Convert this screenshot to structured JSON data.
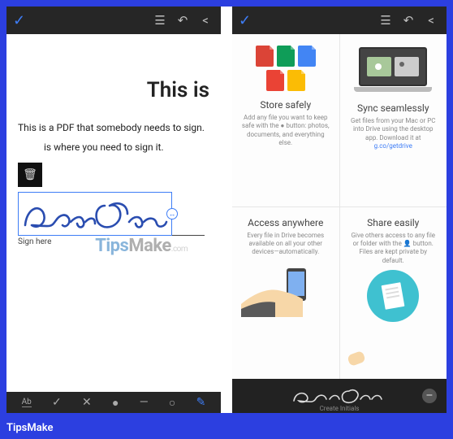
{
  "left": {
    "toolbar": {
      "icons": [
        "align-icon",
        "undo-icon",
        "share-icon"
      ]
    },
    "doc": {
      "heading": "This is",
      "line1": "This is a PDF that somebody needs to sign.",
      "line2": "is where you need to sign it.",
      "sign_here": "Sign here",
      "signature_name": "Jane Doe"
    },
    "toolstrip": [
      "Ab",
      "✓",
      "✕",
      "●",
      "—",
      "○",
      "✎"
    ]
  },
  "right": {
    "cards": [
      {
        "title": "Store safely",
        "desc_a": "Add any file you want to keep safe with the ",
        "desc_b": " button: photos, documents, and everything else."
      },
      {
        "title": "Sync seamlessly",
        "desc_a": "Get files from your Mac or PC into Drive using the desktop app. Download it at ",
        "link": "g.co/getdrive"
      },
      {
        "title": "Access anywhere",
        "desc": "Every file in Drive becomes available on all your other devices—automatically."
      },
      {
        "title": "Share easily",
        "desc": "Give others access to any file or folder with the 👤 button. Files are kept private by default."
      }
    ],
    "sigbar": {
      "signature_name": "Jane Doe",
      "caption": "Create Initials"
    }
  },
  "watermark": {
    "a": "Tips",
    "b": "Make",
    "c": ".com"
  },
  "footer": "TipsMake"
}
